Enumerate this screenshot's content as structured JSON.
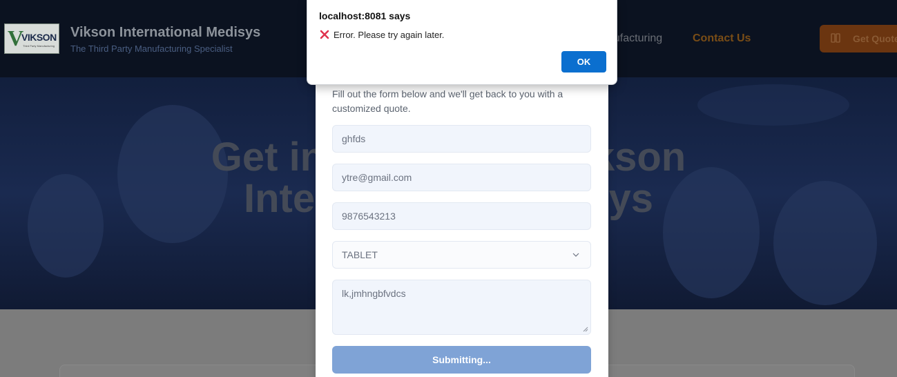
{
  "header": {
    "logo_text": "VIKSON",
    "logo_tagline": "Third Party Manufacturing",
    "brand_name": "Vikson International Medisys",
    "brand_tagline": "The Third Party Manufacturing Specialist",
    "nav": [
      {
        "label": "nufacturing"
      },
      {
        "label": "Contact Us"
      }
    ],
    "quote_button": "Get Quote",
    "quote_icon": "clipboard-icon"
  },
  "hero": {
    "title_line1": "Get in Touch with Vikson",
    "title_line2": "International Medisys"
  },
  "form": {
    "intro": "Fill out the form below and we'll get back to you with a customized quote.",
    "name_value": "ghfds",
    "email_value": "ytre@gmail.com",
    "phone_value": "9876543213",
    "product_value": "TABLET",
    "message_value": "lk,jmhngbfvdcs",
    "submit_label": "Submitting..."
  },
  "alert": {
    "title": "localhost:8081 says",
    "icon": "error-x-icon",
    "message": "Error. Please try again later.",
    "ok_label": "OK"
  },
  "colors": {
    "header_bg": "#0b1220",
    "accent": "#7a4d16",
    "submit_bg": "#7fa3d6",
    "ok_bg": "#0b6fcf",
    "error_icon": "#e0334f"
  }
}
